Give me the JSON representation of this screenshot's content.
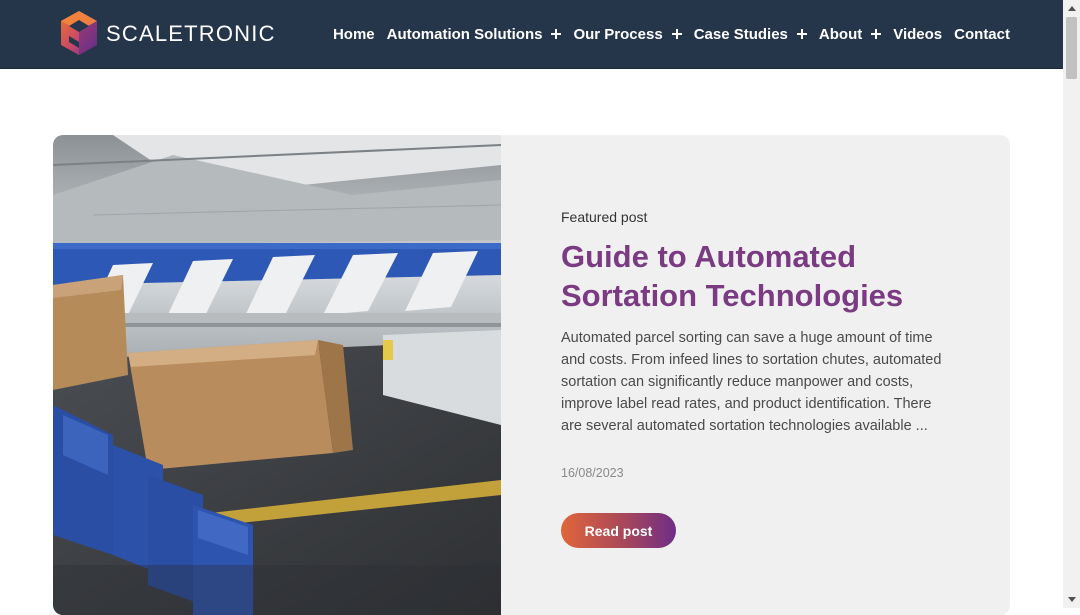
{
  "brand": {
    "name": "SCALETRONIC"
  },
  "nav": {
    "items": [
      {
        "label": "Home",
        "has_submenu": false
      },
      {
        "label": "Automation Solutions",
        "has_submenu": true
      },
      {
        "label": "Our Process",
        "has_submenu": true
      },
      {
        "label": "Case Studies",
        "has_submenu": true
      },
      {
        "label": "About",
        "has_submenu": true
      },
      {
        "label": "Videos",
        "has_submenu": false
      },
      {
        "label": "Contact",
        "has_submenu": false
      }
    ]
  },
  "featured": {
    "kicker": "Featured post",
    "title": "Guide to Automated Sortation Technologies",
    "excerpt": "Automated parcel sorting can save a huge amount of time and costs. From infeed lines to sortation chutes, automated sortation can significantly reduce manpower and costs, improve label read rates, and product identification. There are several automated sortation technologies available ...",
    "date": "16/08/2023",
    "cta": "Read post"
  },
  "colors": {
    "header_bg": "#25354a",
    "title": "#7b3b82",
    "card_bg": "#f1f0f0",
    "button_gradient_start": "#e0663a",
    "button_gradient_end": "#6f2d86"
  },
  "icons": {
    "logo": "hexagon-cube-logo",
    "submenu": "plus-icon",
    "scroll_up": "triangle-up-icon",
    "scroll_down": "triangle-down-icon"
  }
}
